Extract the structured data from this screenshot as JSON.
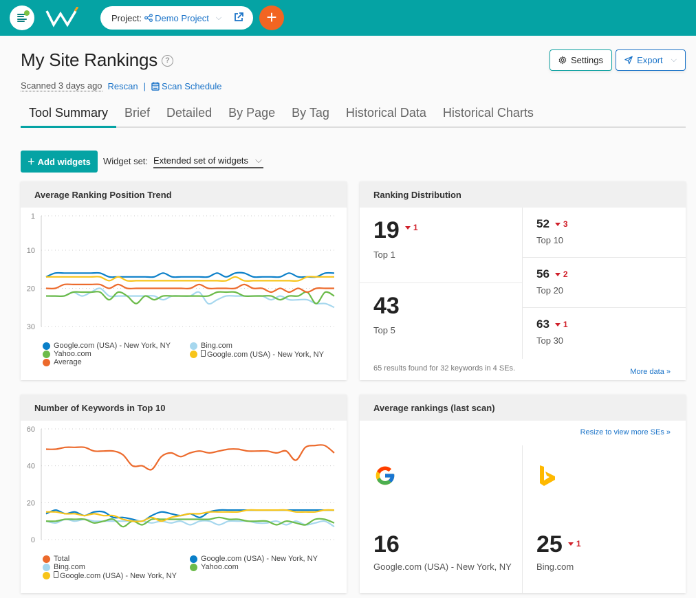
{
  "topbar": {
    "project_label": "Project:",
    "project_name": "Demo Project",
    "add_label": "+"
  },
  "header": {
    "title": "My Site Rankings",
    "help": "?",
    "scanned": "Scanned 3 days ago",
    "rescan": "Rescan",
    "separator": "|",
    "scan_schedule": "Scan Schedule",
    "settings": "Settings",
    "export": "Export"
  },
  "tabs": [
    "Tool Summary",
    "Brief",
    "Detailed",
    "By Page",
    "By Tag",
    "Historical Data",
    "Historical Charts"
  ],
  "toolbar": {
    "add_widgets": "Add widgets",
    "widget_set_label": "Widget set:",
    "widget_set_value": "Extended set of widgets"
  },
  "colors": {
    "brand": "#05a3a4",
    "accent": "#f26522",
    "link": "#1a73c8",
    "negative": "#d0202a"
  },
  "widgets": {
    "trend": {
      "title": "Average Ranking Position Trend",
      "legend": [
        {
          "label": "Google.com (USA) - New York, NY",
          "color": "#0a7fc8",
          "mobile": false
        },
        {
          "label": "Bing.com",
          "color": "#a6d7ee",
          "mobile": false
        },
        {
          "label": "Yahoo.com",
          "color": "#6cbb4a",
          "mobile": false
        },
        {
          "label": "Google.com (USA) - New York, NY",
          "color": "#f7c41a",
          "mobile": true
        },
        {
          "label": "Average",
          "color": "#ec6a2c",
          "mobile": false
        }
      ]
    },
    "distribution": {
      "title": "Ranking Distribution",
      "cells": [
        {
          "value": "19",
          "delta": "1",
          "label": "Top 1"
        },
        {
          "value": "43",
          "delta": "",
          "label": "Top 5"
        },
        {
          "value": "52",
          "delta": "3",
          "label": "Top 10"
        },
        {
          "value": "56",
          "delta": "2",
          "label": "Top 20"
        },
        {
          "value": "63",
          "delta": "1",
          "label": "Top 30"
        }
      ],
      "footer": "65 results found for 32 keywords in 4 SEs.",
      "more": "More data »"
    },
    "top10": {
      "title": "Number of Keywords in Top 10",
      "legend": [
        {
          "label": "Total",
          "color": "#ec6a2c",
          "mobile": false
        },
        {
          "label": "Google.com (USA) - New York, NY",
          "color": "#0a7fc8",
          "mobile": false
        },
        {
          "label": "Bing.com",
          "color": "#a6d7ee",
          "mobile": false
        },
        {
          "label": "Yahoo.com",
          "color": "#6cbb4a",
          "mobile": false
        },
        {
          "label": "Google.com (USA) - New York, NY",
          "color": "#f7c41a",
          "mobile": true
        }
      ]
    },
    "avg": {
      "title": "Average rankings (last scan)",
      "resize": "Resize to view more SEs »",
      "engines": [
        {
          "icon": "google-logo-icon",
          "value": "16",
          "delta": "",
          "label": "Google.com (USA) - New York, NY"
        },
        {
          "icon": "bing-logo-icon",
          "value": "25",
          "delta": "1",
          "label": "Bing.com"
        }
      ]
    }
  },
  "chart_data": [
    {
      "type": "line",
      "title": "Average Ranking Position Trend",
      "ylim": [
        30,
        1
      ],
      "yticks": [
        1,
        10,
        20,
        30
      ],
      "y_inverted": true,
      "grid": true,
      "legend_position": "bottom",
      "series": [
        {
          "name": "Google.com (USA) - New York, NY",
          "color": "#0a7fc8",
          "values": [
            17,
            16,
            16,
            16,
            16,
            16,
            16,
            17,
            17,
            17,
            17,
            17,
            17,
            16,
            17,
            17,
            17,
            17,
            17,
            16,
            17,
            16,
            16,
            17,
            17,
            17,
            17,
            16,
            17,
            17,
            17,
            16,
            16
          ]
        },
        {
          "name": "Bing.com",
          "color": "#a6d7ee",
          "values": [
            22,
            22,
            22,
            21,
            22,
            21,
            20,
            22,
            22,
            22,
            22,
            22,
            22,
            23,
            22,
            22,
            22,
            21,
            24,
            23,
            22,
            22,
            22,
            22,
            22,
            23,
            22,
            23,
            23,
            23,
            24,
            24,
            25
          ]
        },
        {
          "name": "Yahoo.com",
          "color": "#6cbb4a",
          "values": [
            22,
            22,
            22,
            21,
            21,
            21,
            21,
            23,
            21,
            22,
            24,
            22,
            23,
            22,
            22,
            22,
            22,
            22,
            22,
            21,
            21,
            21,
            22,
            22,
            22,
            22,
            23,
            22,
            22,
            21,
            24,
            21,
            22
          ]
        },
        {
          "name": "Google.com (USA) - New York, NY (mobile)",
          "color": "#f7c41a",
          "values": [
            17,
            17,
            17,
            17,
            17,
            17,
            17,
            18,
            17,
            18,
            18,
            18,
            18,
            18,
            18,
            18,
            18,
            18,
            18,
            18,
            18,
            17,
            18,
            18,
            18,
            18,
            18,
            18,
            18,
            17,
            17,
            17,
            17
          ]
        },
        {
          "name": "Average",
          "color": "#ec6a2c",
          "values": [
            20,
            20,
            19,
            19,
            19,
            19,
            19,
            20,
            19,
            20,
            20,
            20,
            20,
            20,
            20,
            20,
            20,
            19,
            20,
            20,
            20,
            20,
            19,
            20,
            20,
            21,
            20,
            21,
            20,
            21,
            20,
            20,
            20
          ]
        }
      ]
    },
    {
      "type": "line",
      "title": "Number of Keywords in Top 10",
      "ylim": [
        0,
        60
      ],
      "yticks": [
        0,
        20,
        40,
        60
      ],
      "grid": true,
      "legend_position": "bottom",
      "series": [
        {
          "name": "Total",
          "color": "#ec6a2c",
          "values": [
            49,
            49,
            50,
            50,
            50,
            48,
            48,
            48,
            46,
            40,
            40,
            38,
            45,
            47,
            45,
            47,
            48,
            47,
            48,
            49,
            49,
            48,
            48,
            48,
            47,
            48,
            43,
            50,
            51,
            51,
            47
          ]
        },
        {
          "name": "Google.com (USA) - New York, NY",
          "color": "#0a7fc8",
          "values": [
            14,
            16,
            14,
            15,
            13,
            15,
            15,
            12,
            12,
            11,
            10,
            13,
            15,
            14,
            13,
            14,
            12,
            15,
            16,
            16,
            16,
            16,
            16,
            16,
            16,
            16,
            16,
            16,
            16,
            16,
            16
          ]
        },
        {
          "name": "Bing.com",
          "color": "#a6d7ee",
          "values": [
            10,
            9,
            11,
            10,
            11,
            10,
            10,
            10,
            10,
            10,
            10,
            9,
            10,
            9,
            10,
            8,
            10,
            10,
            8,
            10,
            10,
            10,
            9,
            9,
            10,
            8,
            10,
            8,
            9,
            10,
            7
          ]
        },
        {
          "name": "Yahoo.com",
          "color": "#6cbb4a",
          "values": [
            10,
            10,
            11,
            11,
            11,
            9,
            10,
            11,
            7,
            10,
            8,
            11,
            11,
            11,
            11,
            11,
            11,
            11,
            12,
            11,
            11,
            10,
            10,
            10,
            8,
            10,
            9,
            8,
            11,
            11,
            9
          ]
        },
        {
          "name": "Google.com (USA) - New York, NY (mobile)",
          "color": "#f7c41a",
          "values": [
            15,
            15,
            14,
            14,
            13,
            14,
            13,
            13,
            11,
            10,
            10,
            12,
            10,
            12,
            13,
            14,
            14,
            15,
            15,
            15,
            15,
            16,
            16,
            16,
            16,
            16,
            15,
            15,
            15,
            16,
            16
          ]
        }
      ]
    }
  ]
}
